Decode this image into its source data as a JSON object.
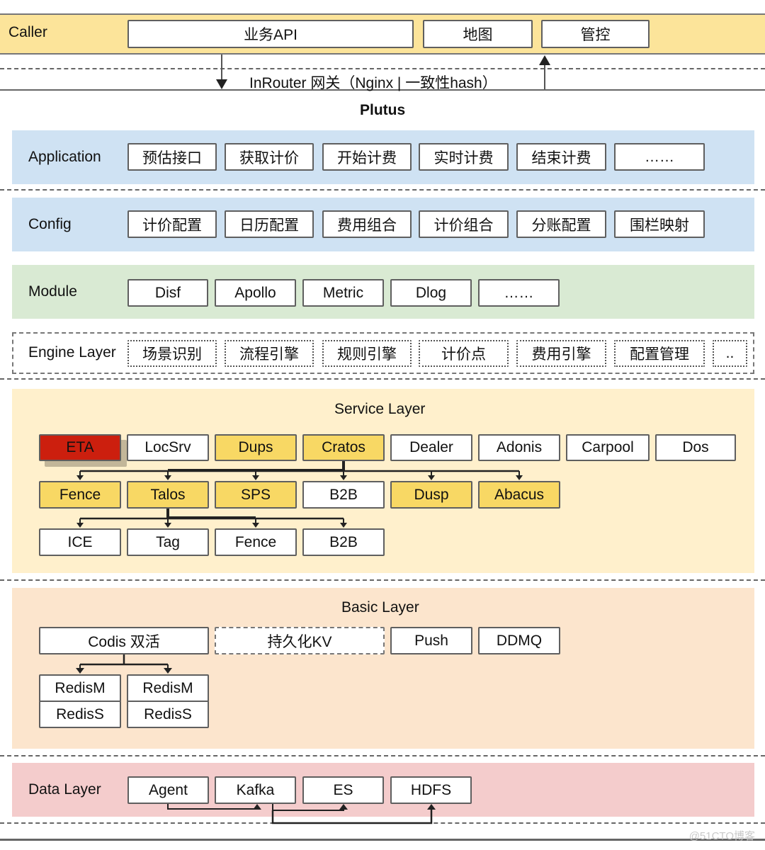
{
  "caller": {
    "label": "Caller",
    "items": [
      "业务API",
      "地图",
      "管控"
    ]
  },
  "gateway": {
    "label": "InRouter 网关（Nginx | 一致性hash）"
  },
  "plutus": {
    "title": "Plutus"
  },
  "application": {
    "label": "Application",
    "items": [
      "预估接口",
      "获取计价",
      "开始计费",
      "实时计费",
      "结束计费",
      "……"
    ]
  },
  "config": {
    "label": "Config",
    "items": [
      "计价配置",
      "日历配置",
      "费用组合",
      "计价组合",
      "分账配置",
      "围栏映射"
    ]
  },
  "module": {
    "label": "Module",
    "items": [
      "Disf",
      "Apollo",
      "Metric",
      "Dlog",
      "……"
    ]
  },
  "engine": {
    "label": "Engine Layer",
    "items": [
      "场景识别",
      "流程引擎",
      "规则引擎",
      "计价点",
      "费用引擎",
      "配置管理",
      ".."
    ]
  },
  "service": {
    "title": "Service Layer",
    "row1": [
      {
        "label": "ETA",
        "style": "red"
      },
      {
        "label": "LocSrv",
        "style": "white"
      },
      {
        "label": "Dups",
        "style": "yellow"
      },
      {
        "label": "Cratos",
        "style": "yellow"
      },
      {
        "label": "Dealer",
        "style": "white"
      },
      {
        "label": "Adonis",
        "style": "white"
      },
      {
        "label": "Carpool",
        "style": "white"
      },
      {
        "label": "Dos",
        "style": "white"
      }
    ],
    "row2": [
      {
        "label": "Fence",
        "style": "yellow"
      },
      {
        "label": "Talos",
        "style": "yellow"
      },
      {
        "label": "SPS",
        "style": "yellow"
      },
      {
        "label": "B2B",
        "style": "white"
      },
      {
        "label": "Dusp",
        "style": "yellow"
      },
      {
        "label": "Abacus",
        "style": "yellow"
      }
    ],
    "row3": [
      {
        "label": "ICE",
        "style": "white"
      },
      {
        "label": "Tag",
        "style": "white"
      },
      {
        "label": "Fence",
        "style": "white"
      },
      {
        "label": "B2B",
        "style": "white"
      }
    ]
  },
  "basic": {
    "title": "Basic Layer",
    "codis": "Codis 双活",
    "kv": "持久化KV",
    "push": "Push",
    "ddmq": "DDMQ",
    "redis": [
      {
        "master": "RedisM",
        "slave": "RedisS"
      },
      {
        "master": "RedisM",
        "slave": "RedisS"
      }
    ]
  },
  "data": {
    "label": "Data Layer",
    "items": [
      "Agent",
      "Kafka",
      "ES",
      "HDFS"
    ]
  },
  "colors": {
    "caller_bg": "#fce49a",
    "application_bg": "#cfe2f3",
    "config_bg": "#cfe2f3",
    "module_bg": "#d9ead3",
    "service_bg": "#fff0cc",
    "basic_bg": "#fce5cd",
    "data_bg": "#f4cccc",
    "eta_red": "#cc1f0e",
    "highlight_yellow": "#f8d864"
  },
  "watermark": "@51CTO博客"
}
